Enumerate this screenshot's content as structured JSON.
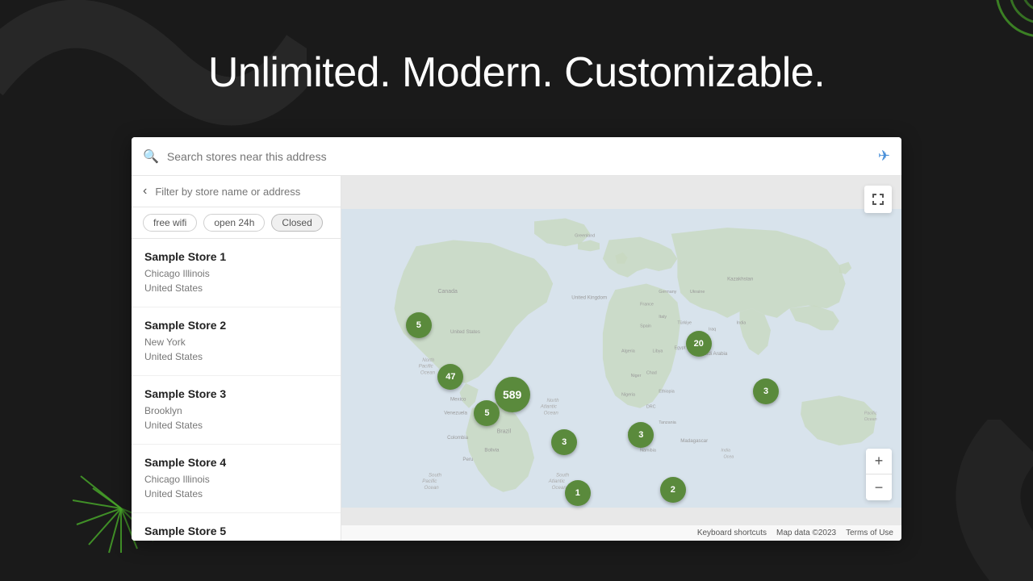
{
  "page": {
    "heading": "Unlimited. Modern. Customizable."
  },
  "search_bar": {
    "placeholder": "Search stores near this address",
    "location_icon": "location-arrow-icon"
  },
  "sidebar": {
    "filter_placeholder": "Filter by store name or address",
    "back_icon": "back-arrow-icon",
    "filter_tags": [
      {
        "label": "free wifi",
        "active": false
      },
      {
        "label": "open 24h",
        "active": false
      },
      {
        "label": "Closed",
        "active": true
      }
    ],
    "stores": [
      {
        "name": "Sample Store 1",
        "city": "Chicago Illinois",
        "country": "United States"
      },
      {
        "name": "Sample Store 2",
        "city": "New York",
        "country": "United States"
      },
      {
        "name": "Sample Store 3",
        "city": "Brooklyn",
        "country": "United States"
      },
      {
        "name": "Sample Store 4",
        "city": "Chicago Illinois",
        "country": "United States"
      },
      {
        "name": "Sample Store 5",
        "city": "",
        "country": ""
      }
    ]
  },
  "map": {
    "markers": [
      {
        "label": "5",
        "x": "15.4",
        "y": "43",
        "size": "normal"
      },
      {
        "label": "47",
        "x": "20.2",
        "y": "55",
        "size": "normal"
      },
      {
        "label": "589",
        "x": "31.4",
        "y": "60",
        "size": "large"
      },
      {
        "label": "20",
        "x": "64.5",
        "y": "47",
        "size": "normal"
      },
      {
        "label": "5",
        "x": "27.5",
        "y": "65",
        "size": "normal"
      },
      {
        "label": "3",
        "x": "40.8",
        "y": "73",
        "size": "normal"
      },
      {
        "label": "1",
        "x": "43.5",
        "y": "88",
        "size": "normal"
      },
      {
        "label": "2",
        "x": "60.4",
        "y": "87",
        "size": "normal"
      },
      {
        "label": "3",
        "x": "55.1",
        "y": "72",
        "size": "normal"
      },
      {
        "label": "3",
        "x": "76.4",
        "y": "60",
        "size": "normal"
      }
    ],
    "footer": {
      "keyboard_shortcuts": "Keyboard shortcuts",
      "map_data": "Map data ©2023",
      "terms": "Terms of Use"
    },
    "zoom_in_label": "+",
    "zoom_out_label": "−",
    "fullscreen_icon": "fullscreen-icon"
  }
}
